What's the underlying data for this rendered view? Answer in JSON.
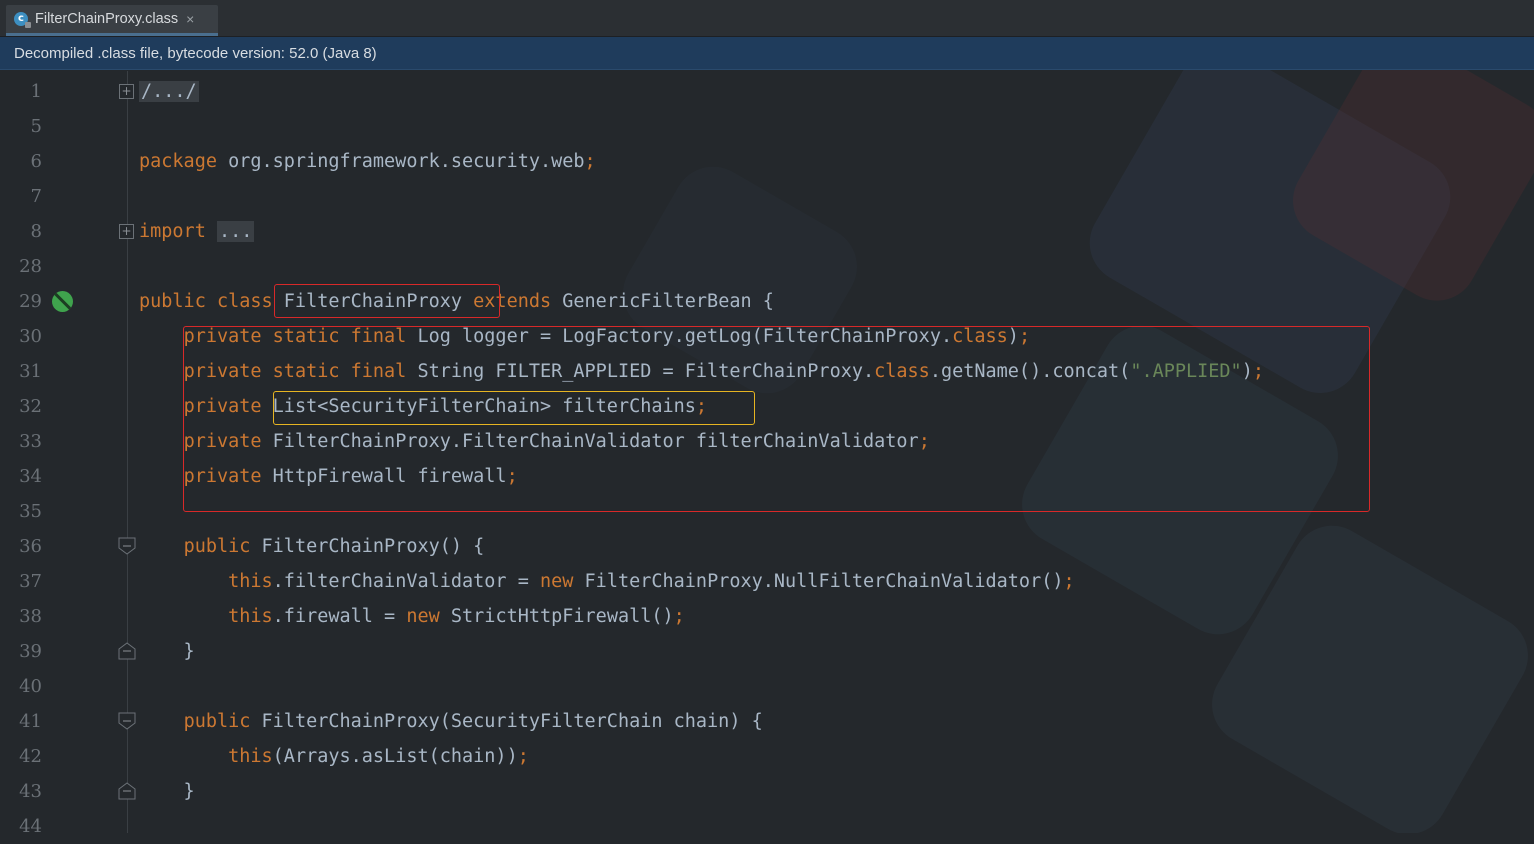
{
  "tab": {
    "title": "FilterChainProxy.class",
    "icon": "class-file-icon",
    "close": "×"
  },
  "banner": {
    "text": "Decompiled .class file, bytecode version: 52.0 (Java 8)"
  },
  "lines": [
    {
      "n": "1",
      "code": [
        {
          "c": "folded",
          "t": "/.../"
        }
      ]
    },
    {
      "n": "5",
      "code": []
    },
    {
      "n": "6",
      "code": [
        {
          "c": "kw",
          "t": "package "
        },
        {
          "c": "",
          "t": "org.springframework.security.web"
        },
        {
          "c": "punc",
          "t": ";"
        }
      ]
    },
    {
      "n": "7",
      "code": []
    },
    {
      "n": "8",
      "code": [
        {
          "c": "kw",
          "t": "import "
        },
        {
          "c": "folded",
          "t": "..."
        }
      ]
    },
    {
      "n": "28",
      "code": []
    },
    {
      "n": "29",
      "code": [
        {
          "c": "kw",
          "t": "public class "
        },
        {
          "c": "",
          "t": "FilterChainProxy "
        },
        {
          "c": "kw",
          "t": "extends "
        },
        {
          "c": "",
          "t": "GenericFilterBean {"
        }
      ]
    },
    {
      "n": "30",
      "code": [
        {
          "c": "",
          "t": "    "
        },
        {
          "c": "kw",
          "t": "private static final "
        },
        {
          "c": "",
          "t": "Log logger = LogFactory.getLog(FilterChainProxy."
        },
        {
          "c": "kw",
          "t": "class"
        },
        {
          "c": "",
          "t": ")"
        },
        {
          "c": "punc",
          "t": ";"
        }
      ]
    },
    {
      "n": "31",
      "code": [
        {
          "c": "",
          "t": "    "
        },
        {
          "c": "kw",
          "t": "private static final "
        },
        {
          "c": "",
          "t": "String FILTER_APPLIED = FilterChainProxy."
        },
        {
          "c": "kw",
          "t": "class"
        },
        {
          "c": "",
          "t": ".getName().concat("
        },
        {
          "c": "str",
          "t": "\".APPLIED\""
        },
        {
          "c": "",
          "t": ")"
        },
        {
          "c": "punc",
          "t": ";"
        }
      ]
    },
    {
      "n": "32",
      "code": [
        {
          "c": "",
          "t": "    "
        },
        {
          "c": "kw",
          "t": "private "
        },
        {
          "c": "",
          "t": "List<SecurityFilterChain> filterChains"
        },
        {
          "c": "punc",
          "t": ";"
        }
      ]
    },
    {
      "n": "33",
      "code": [
        {
          "c": "",
          "t": "    "
        },
        {
          "c": "kw",
          "t": "private "
        },
        {
          "c": "",
          "t": "FilterChainProxy.FilterChainValidator filterChainValidator"
        },
        {
          "c": "punc",
          "t": ";"
        }
      ]
    },
    {
      "n": "34",
      "code": [
        {
          "c": "",
          "t": "    "
        },
        {
          "c": "kw",
          "t": "private "
        },
        {
          "c": "",
          "t": "HttpFirewall firewall"
        },
        {
          "c": "punc",
          "t": ";"
        }
      ]
    },
    {
      "n": "35",
      "code": []
    },
    {
      "n": "36",
      "code": [
        {
          "c": "",
          "t": "    "
        },
        {
          "c": "kw",
          "t": "public "
        },
        {
          "c": "",
          "t": "FilterChainProxy() {"
        }
      ]
    },
    {
      "n": "37",
      "code": [
        {
          "c": "",
          "t": "        "
        },
        {
          "c": "kw",
          "t": "this"
        },
        {
          "c": "",
          "t": ".filterChainValidator = "
        },
        {
          "c": "kw",
          "t": "new "
        },
        {
          "c": "",
          "t": "FilterChainProxy.NullFilterChainValidator()"
        },
        {
          "c": "punc",
          "t": ";"
        }
      ]
    },
    {
      "n": "38",
      "code": [
        {
          "c": "",
          "t": "        "
        },
        {
          "c": "kw",
          "t": "this"
        },
        {
          "c": "",
          "t": ".firewall = "
        },
        {
          "c": "kw",
          "t": "new "
        },
        {
          "c": "",
          "t": "StrictHttpFirewall()"
        },
        {
          "c": "punc",
          "t": ";"
        }
      ]
    },
    {
      "n": "39",
      "code": [
        {
          "c": "",
          "t": "    }"
        }
      ]
    },
    {
      "n": "40",
      "code": []
    },
    {
      "n": "41",
      "code": [
        {
          "c": "",
          "t": "    "
        },
        {
          "c": "kw",
          "t": "public "
        },
        {
          "c": "",
          "t": "FilterChainProxy(SecurityFilterChain chain) {"
        }
      ]
    },
    {
      "n": "42",
      "code": [
        {
          "c": "",
          "t": "        "
        },
        {
          "c": "kw",
          "t": "this"
        },
        {
          "c": "",
          "t": "(Arrays.asList(chain))"
        },
        {
          "c": "punc",
          "t": ";"
        }
      ]
    },
    {
      "n": "43",
      "code": [
        {
          "c": "",
          "t": "    }"
        }
      ]
    },
    {
      "n": "44",
      "code": []
    }
  ],
  "colors": {
    "keyword": "#cc7832",
    "text": "#a9b7c6",
    "string": "#6a8759",
    "highlight_red": "#d82929",
    "highlight_yellow": "#e6b422"
  }
}
